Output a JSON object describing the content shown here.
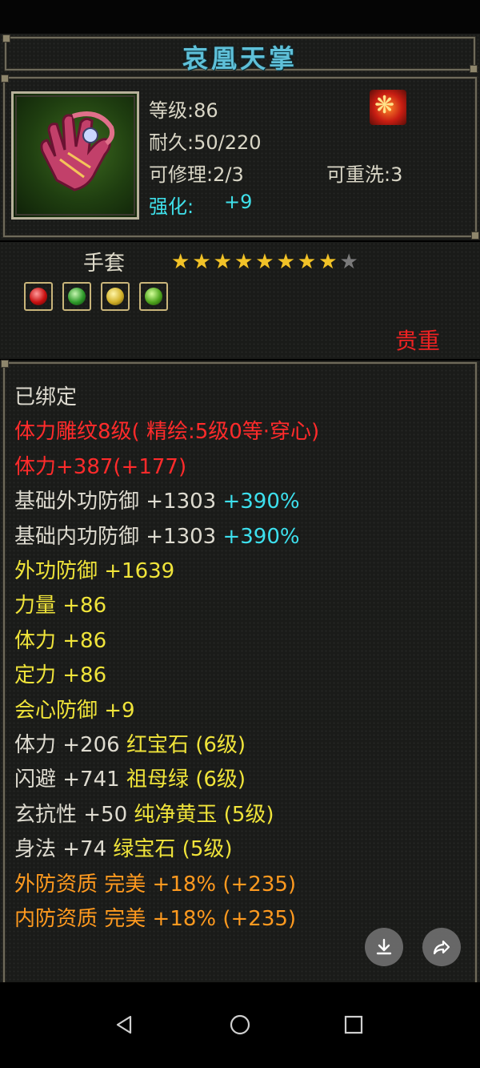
{
  "title": "哀凰天掌",
  "info": {
    "level": "等级:86",
    "durability": "耐久:50/220",
    "repair": "可修理:2/3",
    "rewash": "可重洗:3",
    "enhance_label": "强化:",
    "enhance_value": "+9"
  },
  "item_type": "手套",
  "stars": {
    "filled": 8,
    "total": 9
  },
  "gems": [
    "red-gem-icon",
    "emerald-gem-icon",
    "jade-gem-icon",
    "green-gem-icon"
  ],
  "rarity": "贵重",
  "attributes": [
    {
      "parts": [
        {
          "text": "已绑定",
          "color": "white"
        }
      ]
    },
    {
      "parts": [
        {
          "text": "体力雕纹8级(  精绘:5级0等·穿心)",
          "color": "red"
        }
      ]
    },
    {
      "parts": [
        {
          "text": "体力+387(+177)",
          "color": "red"
        }
      ]
    },
    {
      "parts": [
        {
          "text": "基础外功防御  +1303 ",
          "color": "white"
        },
        {
          "text": "+390%",
          "color": "cyan"
        }
      ]
    },
    {
      "parts": [
        {
          "text": "基础内功防御  +1303 ",
          "color": "white"
        },
        {
          "text": "+390%",
          "color": "cyan"
        }
      ]
    },
    {
      "parts": [
        {
          "text": "外功防御  +1639",
          "color": "yellow"
        }
      ]
    },
    {
      "parts": [
        {
          "text": "力量  +86",
          "color": "yellow"
        }
      ]
    },
    {
      "parts": [
        {
          "text": "体力  +86",
          "color": "yellow"
        }
      ]
    },
    {
      "parts": [
        {
          "text": "定力  +86",
          "color": "yellow"
        }
      ]
    },
    {
      "parts": [
        {
          "text": "会心防御  +9",
          "color": "yellow"
        }
      ]
    },
    {
      "parts": [
        {
          "text": "体力  +206  ",
          "color": "white"
        },
        {
          "text": "红宝石 (6级)",
          "color": "yellow"
        }
      ]
    },
    {
      "parts": [
        {
          "text": "闪避  +741  ",
          "color": "white"
        },
        {
          "text": "祖母绿 (6级)",
          "color": "yellow"
        }
      ]
    },
    {
      "parts": [
        {
          "text": "玄抗性  +50  ",
          "color": "white"
        },
        {
          "text": "纯净黄玉 (5级)",
          "color": "yellow"
        }
      ]
    },
    {
      "parts": [
        {
          "text": "身法  +74  ",
          "color": "white"
        },
        {
          "text": "绿宝石 (5级)",
          "color": "yellow"
        }
      ]
    },
    {
      "parts": [
        {
          "text": "外防资质    完美  +18% (+235)",
          "color": "orange"
        }
      ]
    },
    {
      "parts": [
        {
          "text": "内防资质    完美  +18% (+235)",
          "color": "orange"
        }
      ]
    }
  ],
  "colors": {
    "white": "#dedbd0",
    "red": "#ff2b2b",
    "yellow": "#f0e43a",
    "orange": "#ff9a1f",
    "cyan": "#3de0ee",
    "title": "#5fc0d8",
    "panel": "#1a1b19"
  },
  "actions": {
    "download": "download-icon",
    "share": "share-icon"
  },
  "nav": [
    "back-icon",
    "home-icon",
    "recents-icon"
  ]
}
